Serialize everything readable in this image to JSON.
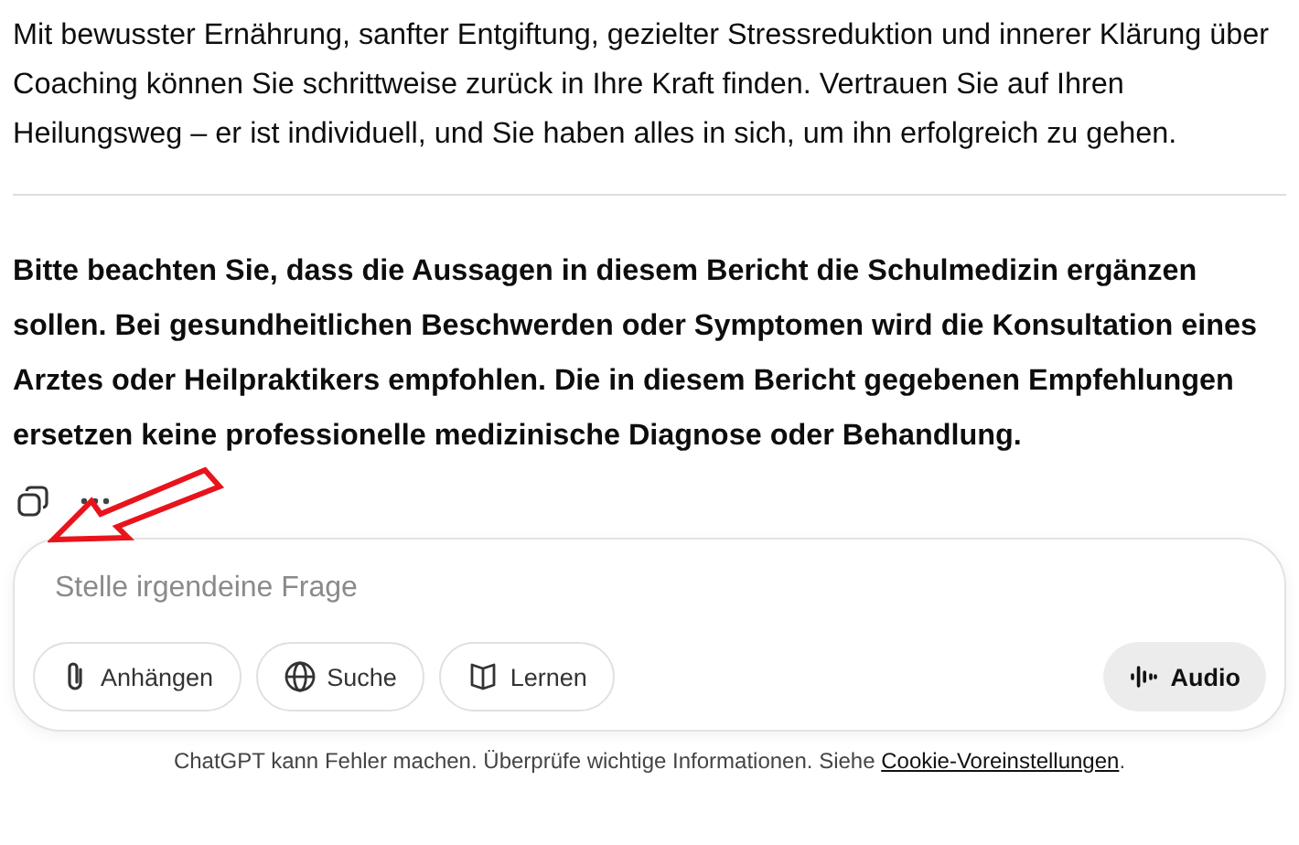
{
  "message": {
    "paragraph": "Mit bewusster Ernährung, sanfter Entgiftung, gezielter Stressreduktion und innerer Klärung über Coaching können Sie schrittweise zurück in Ihre Kraft finden. Vertrauen Sie auf Ihren Heilungsweg – er ist individuell, und Sie haben alles in sich, um ihn erfolgreich zu gehen.",
    "disclaimer": "Bitte beachten Sie, dass die Aussagen in diesem Bericht die Schulmedizin ergänzen sollen. Bei gesundheitlichen Beschwerden oder Symptomen wird die Konsultation eines Arztes oder Heilpraktikers empfohlen. Die in diesem Bericht gegebenen Empfehlungen ersetzen keine professionelle medizinische Diagnose oder Behandlung."
  },
  "composer": {
    "placeholder": "Stelle irgendeine Frage",
    "tools": [
      {
        "kind": "attach",
        "label": "Anhängen"
      },
      {
        "kind": "search",
        "label": "Suche"
      },
      {
        "kind": "learn",
        "label": "Lernen"
      }
    ],
    "audio": "Audio"
  },
  "footer": {
    "text": "ChatGPT kann Fehler machen. Überprüfe wichtige Informationen. Siehe ",
    "link": "Cookie-Voreinstellungen",
    "after": "."
  }
}
